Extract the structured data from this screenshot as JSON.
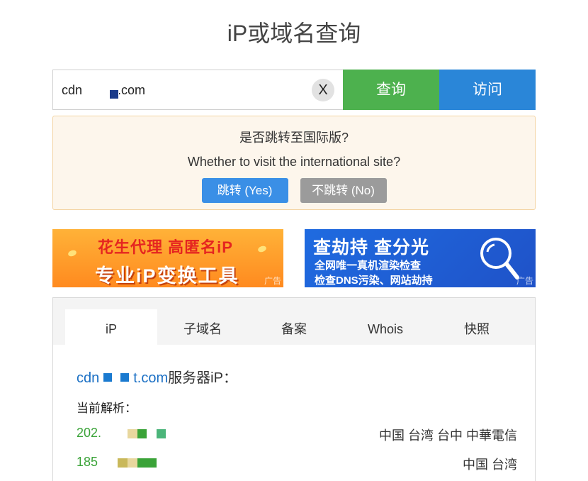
{
  "page": {
    "title": "iP或域名查询"
  },
  "search": {
    "value": "cdn.        t.com",
    "clear_label": "X",
    "query_label": "查询",
    "visit_label": "访问"
  },
  "notice": {
    "question_cn": "是否跳转至国际版?",
    "question_en": "Whether to visit the international site?",
    "yes_label": "跳转 (Yes)",
    "no_label": "不跳转 (No)"
  },
  "ads": {
    "left": {
      "line1": "花生代理 高匿名iP",
      "line2": "专业iP变换工具",
      "tag": "广告"
    },
    "right": {
      "line1": "查劫持 查分光",
      "line2": "全网唯一真机渲染检查",
      "line3": "检查DNS污染、网站劫持",
      "tag": "广告"
    }
  },
  "tabs": [
    {
      "label": "iP"
    },
    {
      "label": "子域名"
    },
    {
      "label": "备案"
    },
    {
      "label": "Whois"
    },
    {
      "label": "快照"
    }
  ],
  "result": {
    "domain_prefix": "cdn",
    "domain_suffix": "t.com",
    "domain_tail": "服务器iP：",
    "current_label": "当前解析：",
    "rows": [
      {
        "ip": "202.",
        "location": "中国 台湾 台中 中華電信"
      },
      {
        "ip": "185",
        "location": "中国 台湾"
      }
    ]
  },
  "colors": {
    "query_green": "#4db14e",
    "visit_blue": "#2a86d8",
    "notice_bg": "#fdf6ec",
    "yes_blue": "#3a8fe6",
    "no_gray": "#9b9b9b",
    "ip_green": "#3aa338",
    "domain_blue": "#1a6fc4"
  }
}
